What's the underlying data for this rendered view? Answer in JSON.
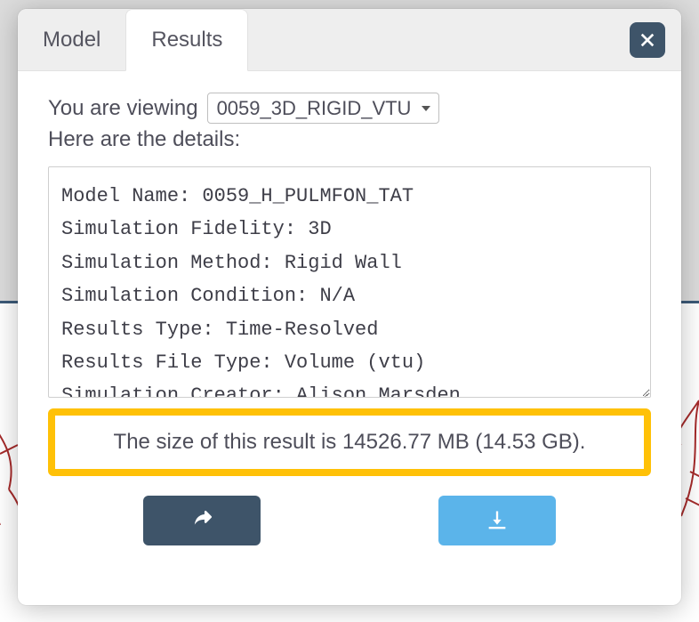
{
  "tabs": {
    "model_label": "Model",
    "results_label": "Results"
  },
  "close_aria": "Close",
  "viewing": {
    "prefix": "You are viewing",
    "selected": "0059_3D_RIGID_VTU",
    "details_label": "Here are the details:"
  },
  "result_details": {
    "lines": [
      "Model Name: 0059_H_PULMFON_TAT",
      "Simulation Fidelity: 3D",
      "Simulation Method: Rigid Wall",
      "Simulation Condition: N/A",
      "Results Type: Time-Resolved",
      "Results File Type: Volume (vtu)",
      "Simulation Creator: Alison Marsden"
    ]
  },
  "size_notice": "The size of this result is 14526.77 MB (14.53 GB).",
  "buttons": {
    "share_name": "share-button",
    "download_name": "download-button"
  }
}
